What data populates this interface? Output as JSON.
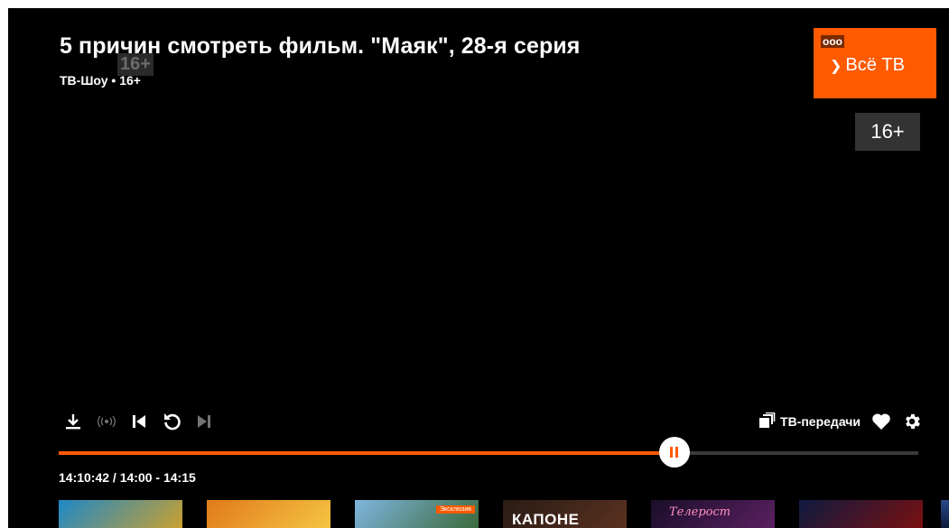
{
  "player": {
    "title": "5 причин смотреть фильм. \"Маяк\", 28-я серия",
    "subtitle": "ТВ-Шоу • 16+",
    "ghost_rating": "16+",
    "channel_logo": {
      "dots": "ооо",
      "name": "Всё ТВ",
      "color": "#ff5a00"
    },
    "age_rating": "16+",
    "controls": {
      "left": [
        "download-icon",
        "live-icon",
        "skip-previous-icon",
        "replay-icon",
        "skip-next-icon"
      ],
      "tv_shows_label": "ТВ-передачи",
      "right": [
        "favorite-heart-icon",
        "settings-gear-icon"
      ]
    },
    "progress": {
      "fraction": 0.716,
      "accent": "#ff5a00"
    },
    "time_label": "14:10:42 / 14:00 - 14:15",
    "thumbnails": [
      {
        "colors": [
          "#1e88c7",
          "#c9a030"
        ],
        "badge": "",
        "overlay": ""
      },
      {
        "colors": [
          "#e07a1a",
          "#f5c542"
        ],
        "badge": "",
        "overlay": ""
      },
      {
        "colors": [
          "#7fb6e0",
          "#3a6a3a"
        ],
        "badge": "Эксклюзив",
        "overlay": ""
      },
      {
        "colors": [
          "#2a1b14",
          "#5a3220"
        ],
        "badge": "",
        "overlay": "КАПОНЕ"
      },
      {
        "colors": [
          "#1a0e2a",
          "#5a2060"
        ],
        "badge": "",
        "overlay": "Телерост"
      },
      {
        "colors": [
          "#0e1a40",
          "#7a1010"
        ],
        "badge": "",
        "overlay": ""
      }
    ]
  }
}
